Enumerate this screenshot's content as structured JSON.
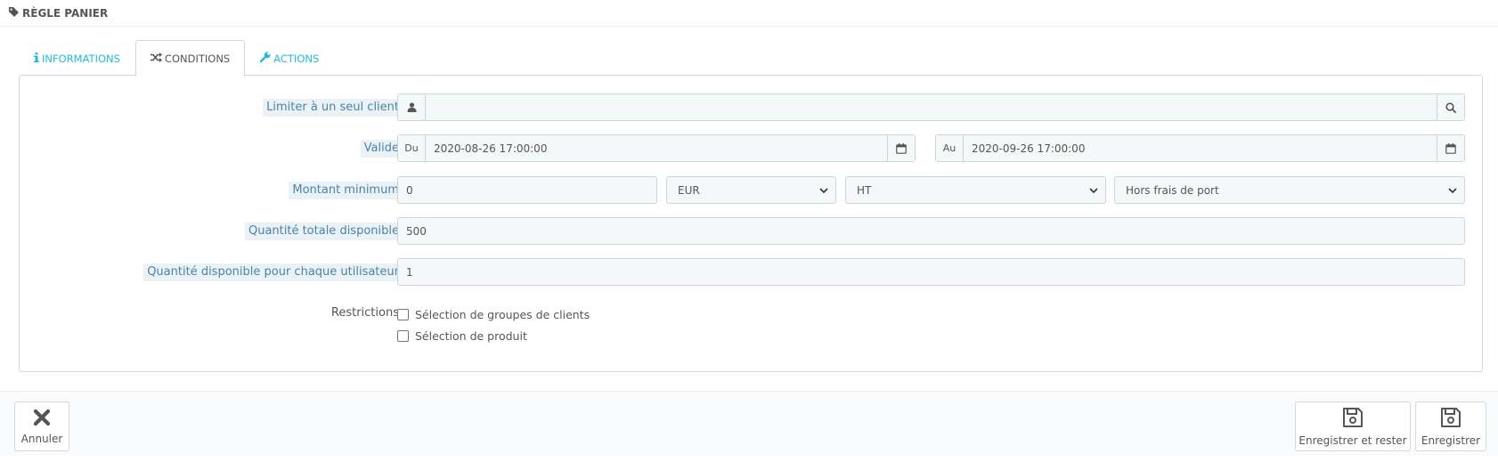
{
  "header": {
    "title": "RÈGLE PANIER",
    "icon": "tag-icon"
  },
  "tabs": [
    {
      "label": "INFORMATIONS",
      "icon": "info-icon",
      "active": false
    },
    {
      "label": "CONDITIONS",
      "icon": "shuffle-icon",
      "active": true
    },
    {
      "label": "ACTIONS",
      "icon": "wrench-icon",
      "active": false
    }
  ],
  "form": {
    "customer": {
      "label": "Limiter à un seul client",
      "value": ""
    },
    "validity": {
      "label": "Valide",
      "from_label": "Du",
      "from_value": "2020-08-26 17:00:00",
      "to_label": "Au",
      "to_value": "2020-09-26 17:00:00"
    },
    "minimum": {
      "label": "Montant minimum",
      "value": "0",
      "currency": "EUR",
      "tax": "HT",
      "shipping": "Hors frais de port"
    },
    "total_quantity": {
      "label": "Quantité totale disponible",
      "value": "500"
    },
    "quantity_per_user": {
      "label": "Quantité disponible pour chaque utilisateur",
      "value": "1"
    },
    "restrictions": {
      "label": "Restrictions",
      "options": [
        {
          "label": "Sélection de groupes de clients",
          "checked": false
        },
        {
          "label": "Sélection de produit",
          "checked": false
        }
      ]
    }
  },
  "footer": {
    "cancel_label": "Annuler",
    "save_stay_label": "Enregistrer et rester",
    "save_label": "Enregistrer"
  },
  "colors": {
    "accent": "#25b9d7",
    "label_text": "#4a84a8",
    "label_bg": "#eaf2f6",
    "input_bg": "#f5f8f9",
    "border": "#c7d6db"
  }
}
